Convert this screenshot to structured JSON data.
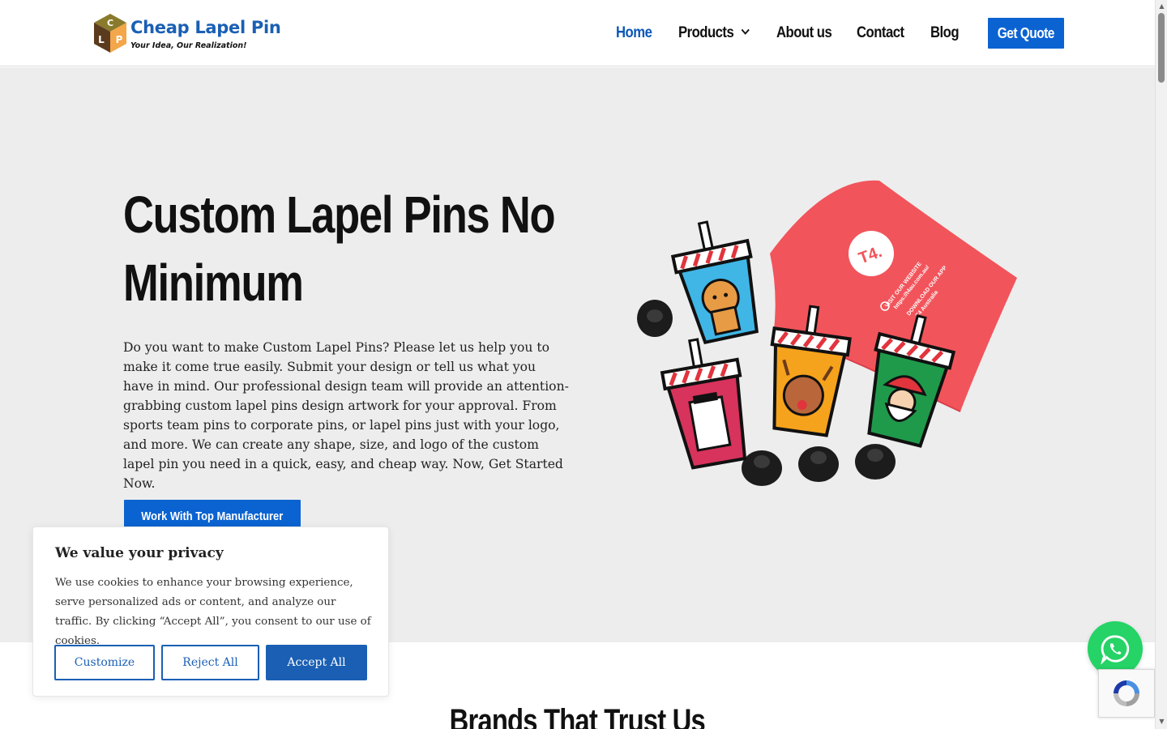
{
  "header": {
    "logo_letters": [
      "C",
      "L",
      "P"
    ],
    "logo_title": "Cheap Lapel Pin",
    "logo_tagline": "Your Idea, Our Realization!",
    "nav": [
      {
        "label": "Home",
        "active": true
      },
      {
        "label": "Products",
        "active": false,
        "has_dropdown": true
      },
      {
        "label": "About us",
        "active": false
      },
      {
        "label": "Contact",
        "active": false
      },
      {
        "label": "Blog",
        "active": false
      }
    ],
    "cta_label": "Get Quote"
  },
  "hero": {
    "title": "Custom Lapel Pins No Minimum",
    "description": "Do you want to make Custom Lapel Pins? Please let us help you to make it come true easily. Submit your design or tell us what you have in mind. Our professional design team will provide an attention-grabbing custom lapel pins design artwork for your approval. From sports team pins to corporate pins, or lapel pins just with your logo, and more. We can create any shape, size, and logo of the custom lapel pin you need in a quick, easy, and cheap way. Now, Get Started Now.",
    "button_label": "Work With Top Manufacturer",
    "image": {
      "pouch_brand": "T4.",
      "pouch_lines": [
        "VISIT OUR WEBSITE",
        "https://t4au.com.au/",
        "DOWNLOAD OUR APP",
        "T4 Australia"
      ]
    }
  },
  "brands": {
    "heading": "Brands That Trust Us"
  },
  "cookie": {
    "title": "We value your privacy",
    "text": "We use cookies to enhance your browsing experience, serve personalized ads or content, and analyze our traffic. By clicking “Accept All”, you consent to our use of cookies.",
    "customize_label": "Customize",
    "reject_label": "Reject All",
    "accept_label": "Accept All"
  },
  "colors": {
    "brand_blue": "#0b63d1",
    "whatsapp_green": "#25d366",
    "hero_bg": "#ededed"
  },
  "icons": {
    "whatsapp": "whatsapp-icon",
    "recaptcha": "recaptcha-icon",
    "dropdown": "chevron-down-icon"
  }
}
